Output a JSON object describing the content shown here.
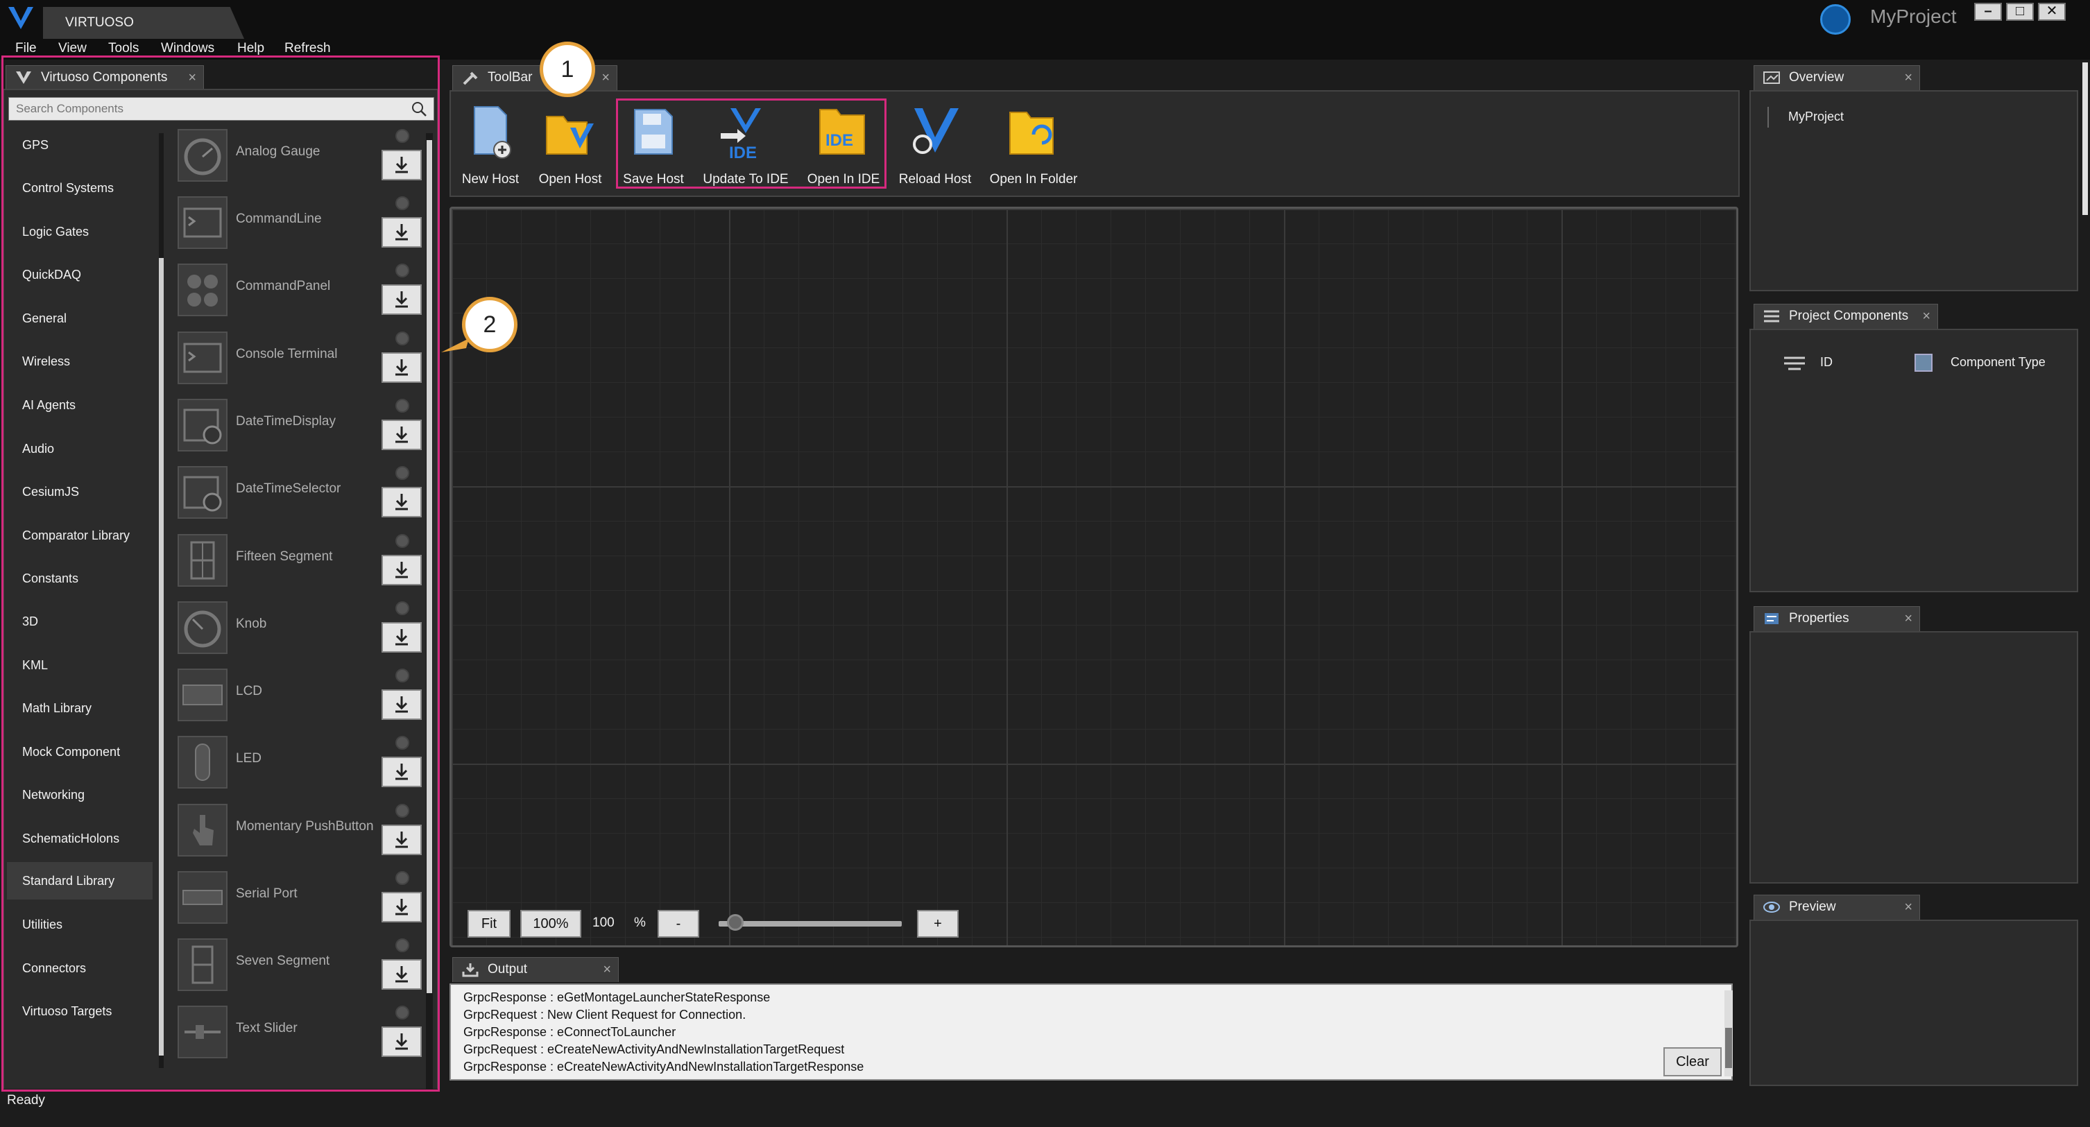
{
  "app": {
    "tab_title": "VIRTUOSO",
    "project_name": "MyProject"
  },
  "menu": [
    "File",
    "View",
    "Tools",
    "Windows",
    "Help",
    "Refresh"
  ],
  "components_panel": {
    "tab_title": "Virtuoso Components",
    "search_placeholder": "Search Components",
    "categories": [
      "GPS",
      "Control Systems",
      "Logic Gates",
      "QuickDAQ",
      "General",
      "Wireless",
      "AI Agents",
      "Audio",
      "CesiumJS",
      "Comparator Library",
      "Constants",
      "3D",
      "KML",
      "Math Library",
      "Mock Component",
      "Networking",
      "SchematicHolons",
      "Standard Library",
      "Utilities",
      "Connectors",
      "Virtuoso Targets"
    ],
    "selected_category": "Standard Library",
    "components": [
      "Analog Gauge",
      "CommandLine",
      "CommandPanel",
      "Console Terminal",
      "DateTimeDisplay",
      "DateTimeSelector",
      "Fifteen Segment",
      "Knob",
      "LCD",
      "LED",
      "Momentary PushButton",
      "Serial Port",
      "Seven Segment",
      "Text Slider"
    ]
  },
  "toolbar": {
    "tab_title": "ToolBar",
    "buttons": [
      "New Host",
      "Open Host",
      "Save Host",
      "Update To IDE",
      "Open In IDE",
      "Reload Host",
      "Open In Folder"
    ]
  },
  "canvas_controls": {
    "fit": "Fit",
    "zoom_preset": "100%",
    "zoom_value": "100",
    "percent": "%",
    "minus": "-",
    "plus": "+"
  },
  "output": {
    "tab_title": "Output",
    "lines": [
      "GrpcResponse : eGetMontageLauncherStateResponse",
      "GrpcRequest : New Client Request for Connection.",
      "GrpcResponse : eConnectToLauncher",
      "GrpcRequest : eCreateNewActivityAndNewInstallationTargetRequest",
      "GrpcResponse : eCreateNewActivityAndNewInstallationTargetResponse"
    ],
    "clear": "Clear"
  },
  "overview": {
    "tab_title": "Overview",
    "root": "MyProject"
  },
  "project_components": {
    "tab_title": "Project Components",
    "col_id": "ID",
    "col_type": "Component Type"
  },
  "properties": {
    "tab_title": "Properties"
  },
  "preview": {
    "tab_title": "Preview"
  },
  "status": "Ready",
  "callouts": [
    "1",
    "2"
  ],
  "colors": {
    "highlight": "#d6297e",
    "callout_border": "#e6a23c",
    "accent_blue": "#1f6fd0"
  }
}
